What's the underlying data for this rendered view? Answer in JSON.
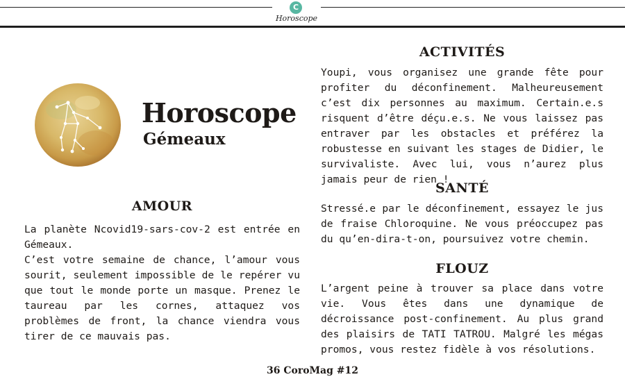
{
  "header": {
    "logo_letter": "C",
    "section_tag": "Horoscope"
  },
  "emblem": {
    "icon": "gemini-constellation-icon"
  },
  "title": {
    "main": "Horoscope",
    "sign": "Gémeaux"
  },
  "amour": {
    "heading": "AMOUR",
    "text": "La planète Ncovid19-sars-cov-2 est entrée en Gémeaux.\nC’est votre semaine de chance, l’amour vous sourit, seulement impossible de le repérer vu que tout le monde porte un masque. Prenez le taureau par les cornes, attaquez vos problèmes de front, la chance viendra vous tirer de ce mauvais pas."
  },
  "activites": {
    "heading": "ACTIVITÉS",
    "text": "Youpi, vous organisez une grande fête pour profiter du déconfinement. Malheureusement c’est dix personnes au maximum. Certain.e.s risquent d’être déçu.e.s. Ne vous laissez pas entraver par les obstacles et préférez la robustesse en suivant les stages de Didier, le survivaliste. Avec lui, vous n’aurez plus jamais peur de rien !"
  },
  "sante": {
    "heading": "SANTÉ",
    "text": "Stressé.e par le déconfinement, essayez le jus de fraise Chloroquine. Ne vous préoccupez pas du qu’en-dira-t-on, poursuivez votre chemin."
  },
  "flouz": {
    "heading": "FLOUZ",
    "text": "L’argent peine à trouver sa place dans votre vie. Vous êtes dans une dynamique de décroissance post-confinement. Au plus grand des plaisirs de TATI TATROU. Malgré les mégas promos, vous restez fidèle à vos résolutions."
  },
  "footer": {
    "text": "36 CoroMag #12"
  }
}
